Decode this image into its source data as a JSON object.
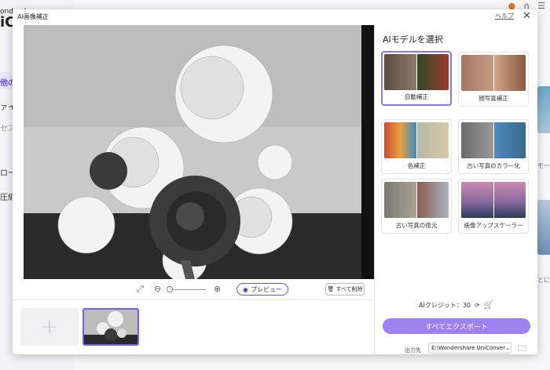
{
  "background": {
    "logo_small": "ondersh",
    "logo_big": "iC",
    "sidebar_items": [
      "他の",
      "ァイル",
      "セス",
      "ロー",
      "圧縮"
    ],
    "top_icons": [
      "user-icon",
      "headset-icon",
      "menu-icon"
    ],
    "right_text_1": "モー",
    "right_text_2": "とに"
  },
  "dialog": {
    "title": "AI画像補正",
    "help": "ヘルプ",
    "close_icon": "close-icon"
  },
  "toolbar": {
    "preview_label": "プレビュー",
    "delete_all_label": "すべて削除",
    "zoom_level": 0
  },
  "model_panel": {
    "heading": "AIモデルを選択",
    "models": [
      {
        "label": "自動補正",
        "selected": true
      },
      {
        "label": "顔写真補正",
        "selected": false
      },
      {
        "label": "色補正",
        "selected": false
      },
      {
        "label": "古い写真のカラー化",
        "selected": false
      },
      {
        "label": "古い写真の復元",
        "selected": false
      },
      {
        "label": "画像アップスケーラー",
        "selected": false
      }
    ]
  },
  "credits": {
    "label": "AIクレジット：30"
  },
  "export": {
    "button_label": "すべてエクスポート",
    "output_label": "出力先",
    "output_path": "E:\\Wondershare UniConver"
  },
  "colors": {
    "accent": "#8d74f0",
    "export_button": "#9b82f0"
  }
}
